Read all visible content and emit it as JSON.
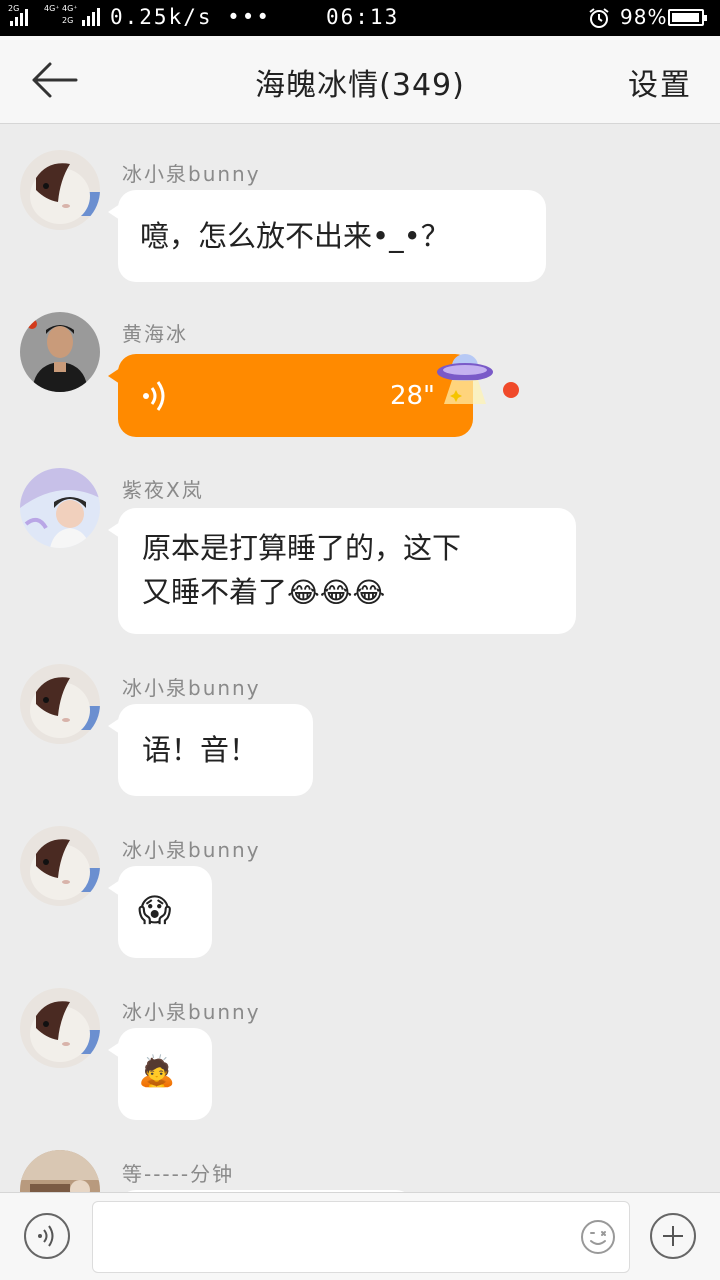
{
  "status_bar": {
    "net1": "2G",
    "net2_top": "4G⁺ 4G⁺",
    "net2_bottom": "2G",
    "speed": "0.25k/s •••",
    "time": "06:13",
    "battery": "98%",
    "battery_level": 0.98
  },
  "header": {
    "back_icon": "arrow-left-icon",
    "title": "海魄冰情(349)",
    "settings_label": "设置"
  },
  "messages": [
    {
      "sender": "冰小泉bunny",
      "text": "噫，怎么放不出来•_•？",
      "avatar": "guinea-pig-avatar"
    },
    {
      "sender": "黄海冰",
      "type": "voice",
      "duration": "28\"",
      "unread": true,
      "avatar": "man-portrait-avatar",
      "decoration": "ufo-icon"
    },
    {
      "sender": "紫夜X岚",
      "text_line1": "原本是打算睡了的，这下",
      "text_line2": "又睡不着了",
      "emojis": [
        "😂",
        "😂",
        "😂"
      ],
      "avatar": "girl-portrait-avatar"
    },
    {
      "sender": "冰小泉bunny",
      "text": "语！音！",
      "avatar": "guinea-pig-avatar"
    },
    {
      "sender": "冰小泉bunny",
      "sticker": "😱",
      "avatar": "guinea-pig-avatar"
    },
    {
      "sender": "冰小泉bunny",
      "sticker": "🙇",
      "avatar": "guinea-pig-avatar"
    },
    {
      "sender": "等-----分钟",
      "avatar": "room-photo-avatar"
    }
  ],
  "input_bar": {
    "voice_icon": "voice-wave-icon",
    "emoji_icon": "smiley-icon",
    "plus_icon": "plus-icon",
    "input_value": ""
  },
  "colors": {
    "accent_orange": "#ff8a00",
    "unread_red": "#f04a2a",
    "background": "#ececec"
  }
}
